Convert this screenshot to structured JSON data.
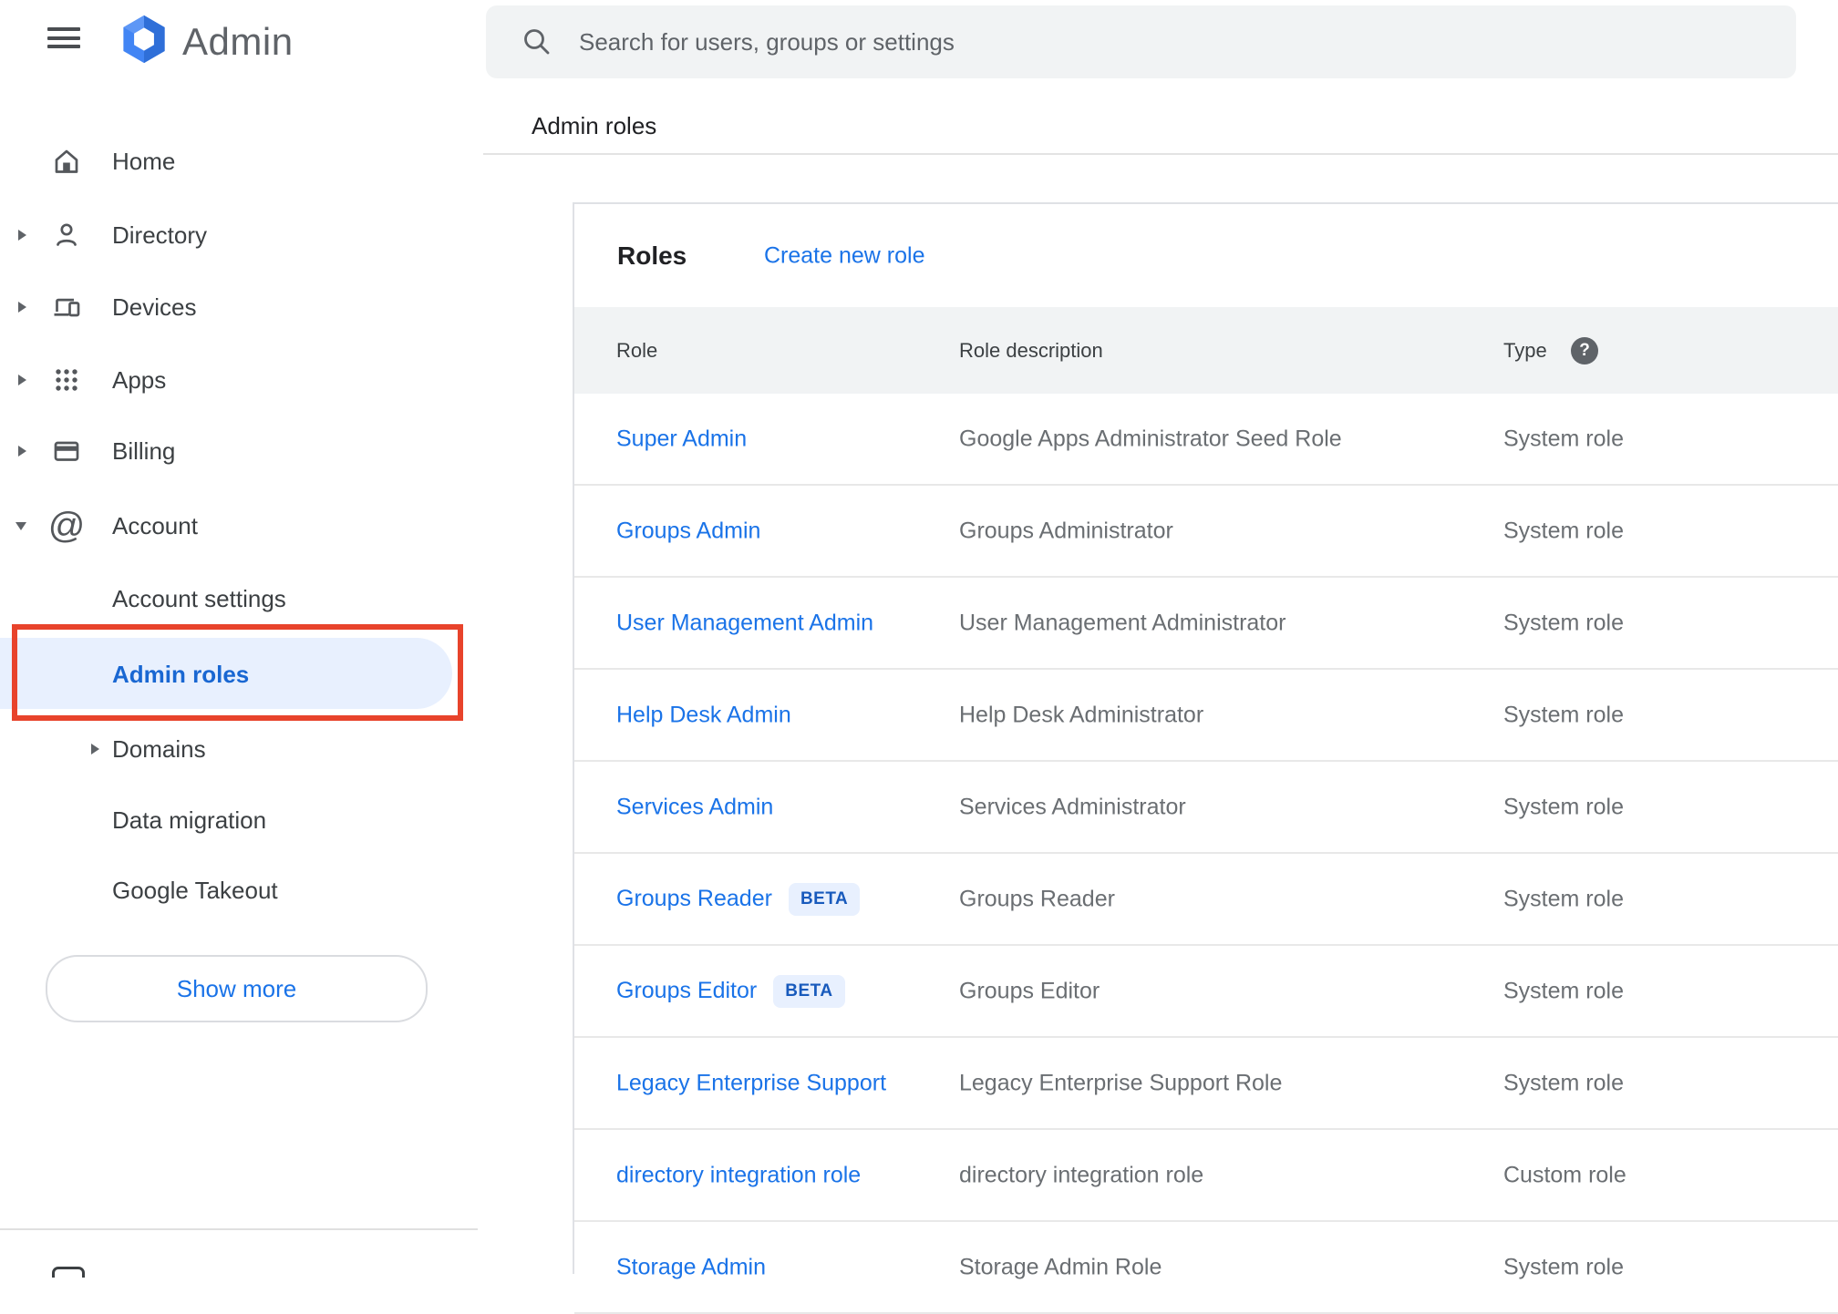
{
  "header": {
    "app_name": "Admin",
    "search_placeholder": "Search for users, groups or settings"
  },
  "sidebar": {
    "items": [
      {
        "id": "home",
        "label": "Home",
        "icon": "home-icon",
        "arrow": "none",
        "sub": false,
        "selected": false
      },
      {
        "id": "directory",
        "label": "Directory",
        "icon": "person-icon",
        "arrow": "right",
        "sub": false,
        "selected": false
      },
      {
        "id": "devices",
        "label": "Devices",
        "icon": "devices-icon",
        "arrow": "right",
        "sub": false,
        "selected": false
      },
      {
        "id": "apps",
        "label": "Apps",
        "icon": "apps-grid-icon",
        "arrow": "right",
        "sub": false,
        "selected": false
      },
      {
        "id": "billing",
        "label": "Billing",
        "icon": "credit-card-icon",
        "arrow": "right",
        "sub": false,
        "selected": false
      },
      {
        "id": "account",
        "label": "Account",
        "icon": "at-sign-icon",
        "arrow": "down",
        "sub": false,
        "selected": false
      },
      {
        "id": "account-settings",
        "label": "Account settings",
        "icon": "none",
        "arrow": "none",
        "sub": true,
        "selected": false
      },
      {
        "id": "admin-roles",
        "label": "Admin roles",
        "icon": "none",
        "arrow": "none",
        "sub": true,
        "selected": true
      },
      {
        "id": "domains",
        "label": "Domains",
        "icon": "none",
        "arrow": "right",
        "sub": true,
        "selected": false
      },
      {
        "id": "data-migration",
        "label": "Data migration",
        "icon": "none",
        "arrow": "none",
        "sub": true,
        "selected": false
      },
      {
        "id": "google-takeout",
        "label": "Google Takeout",
        "icon": "none",
        "arrow": "none",
        "sub": true,
        "selected": false
      }
    ],
    "show_more_label": "Show more"
  },
  "page": {
    "breadcrumb": "Admin roles"
  },
  "roles_card": {
    "title": "Roles",
    "create_link": "Create new role",
    "columns": [
      "Role",
      "Role description",
      "Type"
    ],
    "help_glyph": "?",
    "beta_label": "BETA",
    "rows": [
      {
        "role": "Super Admin",
        "beta": false,
        "description": "Google Apps Administrator Seed Role",
        "type": "System role"
      },
      {
        "role": "Groups Admin",
        "beta": false,
        "description": "Groups Administrator",
        "type": "System role"
      },
      {
        "role": "User Management Admin",
        "beta": false,
        "description": "User Management Administrator",
        "type": "System role"
      },
      {
        "role": "Help Desk Admin",
        "beta": false,
        "description": "Help Desk Administrator",
        "type": "System role"
      },
      {
        "role": "Services Admin",
        "beta": false,
        "description": "Services Administrator",
        "type": "System role"
      },
      {
        "role": "Groups Reader",
        "beta": true,
        "description": "Groups Reader",
        "type": "System role"
      },
      {
        "role": "Groups Editor",
        "beta": true,
        "description": "Groups Editor",
        "type": "System role"
      },
      {
        "role": "Legacy Enterprise Support",
        "beta": false,
        "description": "Legacy Enterprise Support Role",
        "type": "System role"
      },
      {
        "role": "directory integration role",
        "beta": false,
        "description": "directory integration role",
        "type": "Custom role"
      },
      {
        "role": "Storage Admin",
        "beta": false,
        "description": "Storage Admin Role",
        "type": "System role"
      }
    ]
  },
  "colors": {
    "accent_blue": "#1a73e8",
    "selected_blue": "#1967d2",
    "annotation_red": "#e8432b",
    "badge_bg": "#e8f0fe",
    "badge_text": "#185abc",
    "header_band_bg": "#f1f3f4",
    "search_bg": "#f1f3f4",
    "text_gray": "#5f6368",
    "logo_blue": "#4285f4"
  }
}
